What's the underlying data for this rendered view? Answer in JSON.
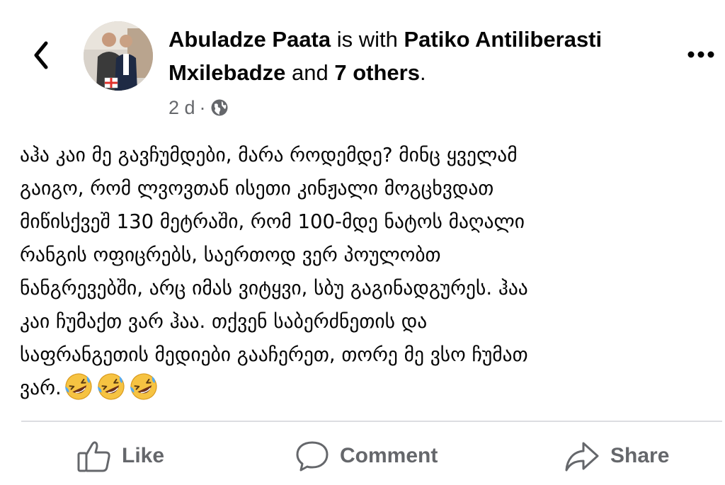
{
  "header": {
    "author": "Abuladze Paata",
    "with_text": " is with ",
    "tagged_name": "Patiko Antiliberasti Mxilebadze",
    "and_text": " and ",
    "others": "7 others",
    "period": ".",
    "time": "2 d",
    "separator": "·",
    "privacy_icon": "globe-icon",
    "back_icon": "chevron-left-icon",
    "more_icon": "more-horizontal-icon"
  },
  "post": {
    "lines": [
      "აჰა კაი მე გავჩუმდები, მარა როდემდე? მინც ყველამ",
      "გაიგო, რომ ლვოვთან ისეთი კინჟალი მოგცხვდათ",
      "მიწისქვეშ 130 მეტრაში, რომ 100-მდე ნატოს  მაღალი",
      "რანგის ოფიცრებს, საერთოდ ვერ პოულობთ",
      "ნანგრევებში, არც იმას ვიტყვი, სბუ გაგინადგურეს. ჰაა",
      "კაი ჩუმაქთ ვარ ჰაა. თქვენ საბერძნეთის და",
      "საფრანგეთის მედიები გააჩერეთ, თორე მე ვსო ჩუმათ",
      "ვარ."
    ],
    "emoji": "rolling-on-the-floor-laughing-emoji",
    "emoji_count": 3
  },
  "actions": {
    "like_label": "Like",
    "comment_label": "Comment",
    "share_label": "Share"
  },
  "colors": {
    "text": "#050505",
    "secondary": "#65676b",
    "divider": "#dcdde1",
    "emoji_yellow": "#f6c342"
  }
}
